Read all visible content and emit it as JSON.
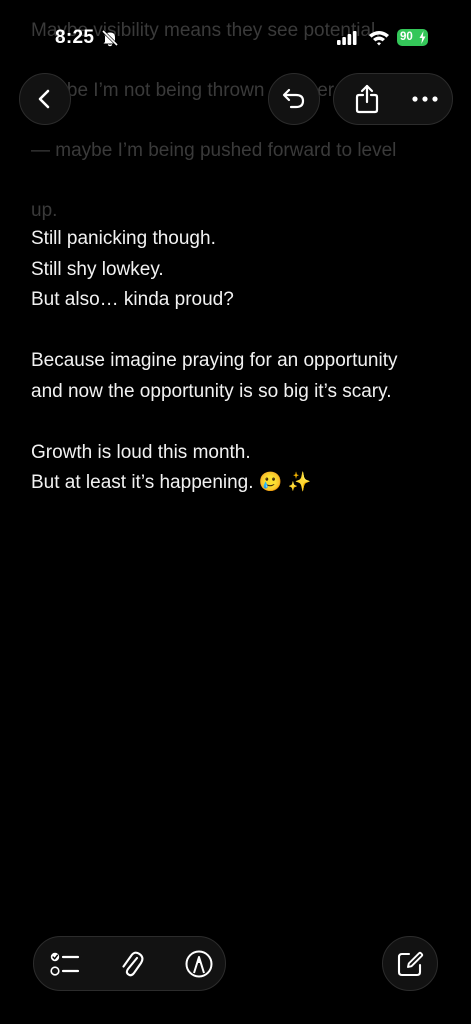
{
  "status_bar": {
    "time": "8:25",
    "battery_level": "90",
    "icons": [
      "bell-off-icon",
      "signal-icon",
      "wifi-icon",
      "battery-icon"
    ]
  },
  "background_text": {
    "lines": [
      "Maybe visibility means they see potential.",
      "Maybe I’m not being thrown out there to fail",
      "— maybe I’m being pushed forward to level",
      "up."
    ]
  },
  "nav": {
    "back_icon": "chevron-left-icon",
    "undo_icon": "undo-icon",
    "share_icon": "share-icon",
    "more_icon": "ellipsis-icon"
  },
  "note": {
    "lines": [
      "Still panicking though.",
      "Still shy lowkey.",
      "But also… kinda proud?",
      "",
      "Because imagine praying for an opportunity",
      "and now the opportunity is so big it’s scary.",
      "",
      "Growth is loud this month.",
      "But at least it’s happening. 🥲 ✨"
    ]
  },
  "toolbar": {
    "checklist_icon": "checklist-icon",
    "attach_icon": "paperclip-icon",
    "markup_icon": "markup-pen-icon",
    "compose_icon": "compose-icon"
  },
  "colors": {
    "background": "#000000",
    "text": "#f2f2f2",
    "button_bg": "#121212",
    "battery": "#34c759"
  }
}
